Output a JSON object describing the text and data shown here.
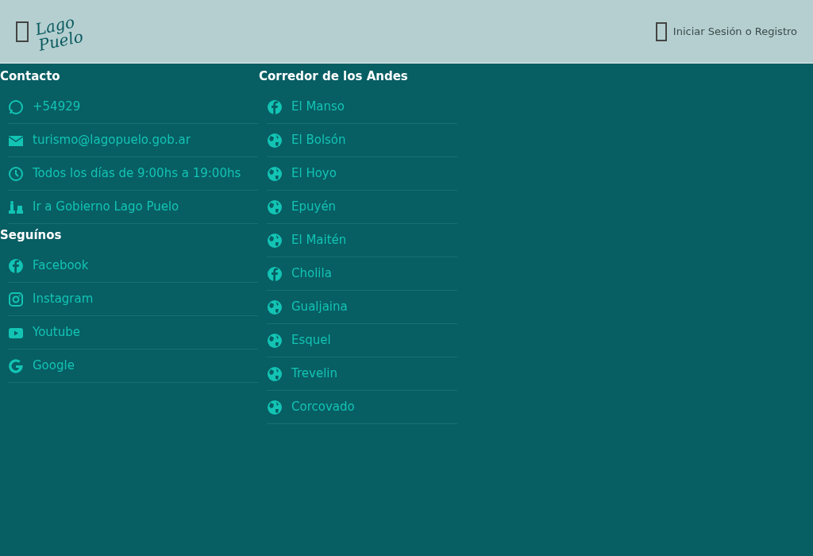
{
  "contact": {
    "title": "Contacto",
    "items": [
      {
        "kind": "whatsapp",
        "text": "+54929"
      },
      {
        "kind": "mail",
        "text": "turismo@lagopuelo.gob.ar"
      },
      {
        "kind": "clock",
        "text": "Todos los días de 9:00hs a 19:00hs"
      },
      {
        "kind": "chess",
        "text": "Ir a Gobierno Lago Puelo"
      }
    ]
  },
  "follow": {
    "title": "Seguínos",
    "items": [
      {
        "kind": "facebook",
        "text": "Facebook"
      },
      {
        "kind": "instagram",
        "text": "Instagram"
      },
      {
        "kind": "youtube",
        "text": "Youtube"
      },
      {
        "kind": "google",
        "text": "Google"
      }
    ]
  },
  "corridor": {
    "title": "Corredor de los Andes",
    "items": [
      {
        "kind": "facebook",
        "text": "El Manso"
      },
      {
        "kind": "globe",
        "text": "El Bolsón"
      },
      {
        "kind": "globe",
        "text": "El Hoyo"
      },
      {
        "kind": "globe",
        "text": "Epuyén"
      },
      {
        "kind": "globe",
        "text": "El Maitén"
      },
      {
        "kind": "facebook",
        "text": "Cholila"
      },
      {
        "kind": "globe",
        "text": "Gualjaina"
      },
      {
        "kind": "globe",
        "text": "Esquel"
      },
      {
        "kind": "globe",
        "text": "Trevelin"
      },
      {
        "kind": "globe",
        "text": "Corcovado"
      }
    ]
  },
  "header": {
    "logo": "Lago Puelo",
    "login": "Iniciar Sesión o Registro"
  }
}
